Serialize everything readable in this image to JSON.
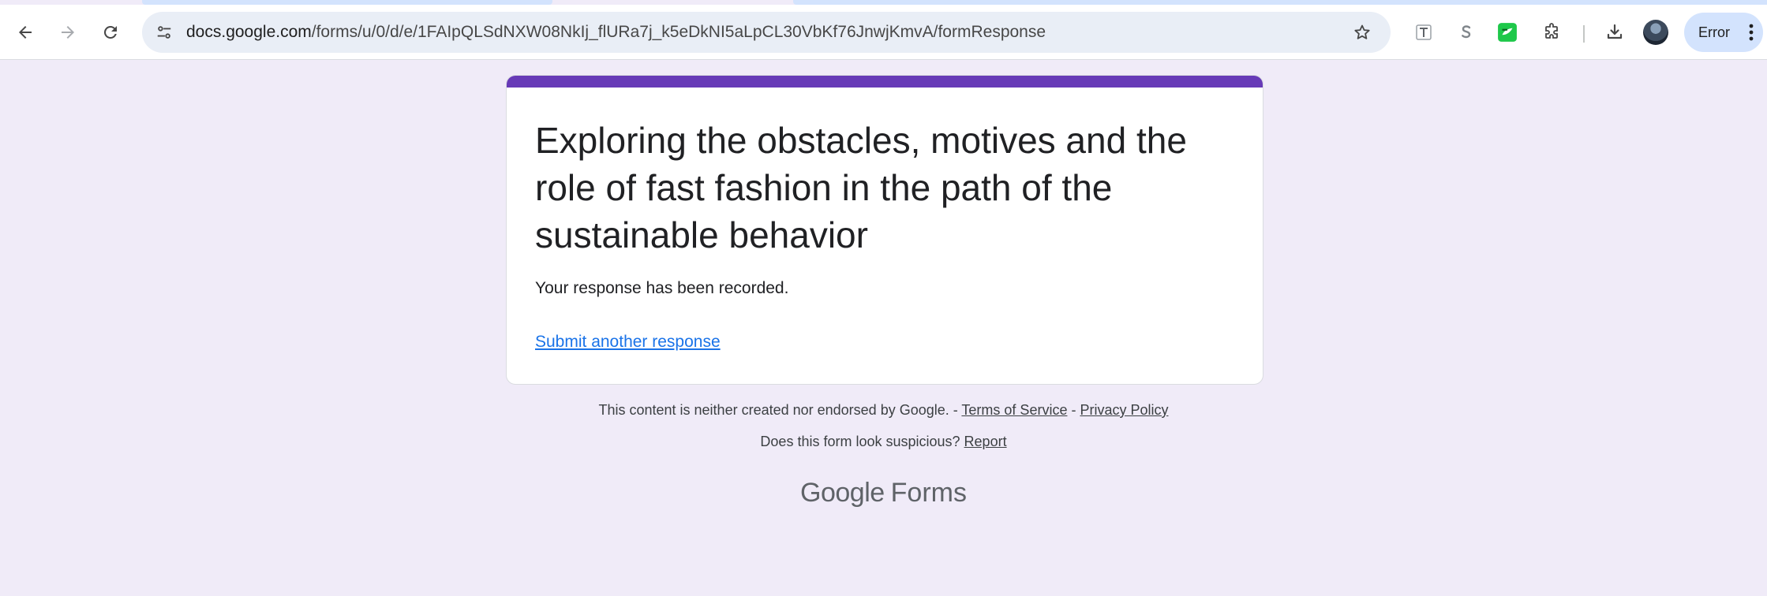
{
  "browser": {
    "url_host": "docs.google.com",
    "url_path": "/forms/u/0/d/e/1FAIpQLSdNXW08NkIj_flURa7j_k5eDkNI5aLpCL30VbKf76JnwjKmvA/formResponse",
    "profile_chip": "Error"
  },
  "form": {
    "title": "Exploring the obstacles, motives and the role of fast fashion in the path of the sustainable behavior",
    "confirmation": "Your response has been recorded.",
    "submit_another": "Submit another response"
  },
  "footer": {
    "disclaimer": "This content is neither created nor endorsed by Google.",
    "sep1": " - ",
    "terms": "Terms of Service",
    "sep2": " - ",
    "privacy": "Privacy Policy",
    "suspicious": "Does this form look suspicious?",
    "report": "Report"
  },
  "brand": {
    "google": "Google",
    "forms": "Forms"
  },
  "colors": {
    "accent": "#673ab7",
    "background": "#f0ebf8",
    "link": "#1a73e8"
  }
}
